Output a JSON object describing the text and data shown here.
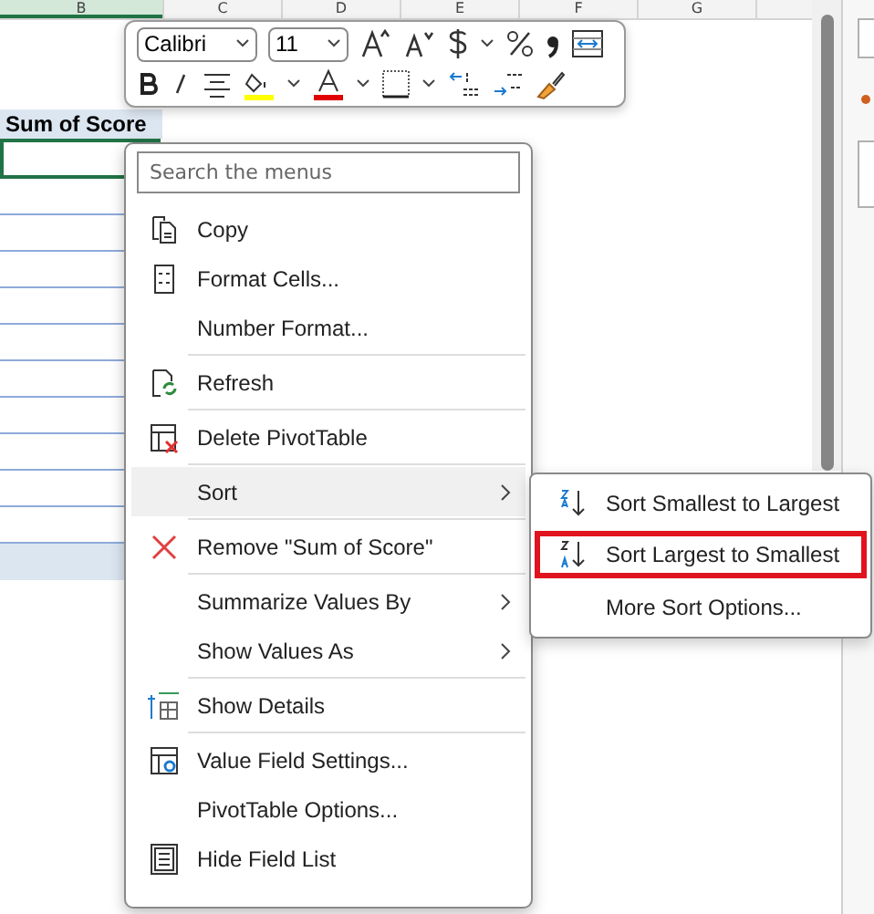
{
  "sheet": {
    "columns": [
      "B",
      "C",
      "D",
      "E",
      "F",
      "G"
    ],
    "pivot_header": "Sum of Score"
  },
  "mini_toolbar": {
    "font": "Calibri",
    "size": "11"
  },
  "context_menu": {
    "search": {
      "placeholder": "Search the menus"
    },
    "items": [
      {
        "label": "Copy",
        "divider_above": false,
        "selected": false,
        "submenu": false
      },
      {
        "label": "Format Cells...",
        "divider_above": false,
        "selected": false,
        "submenu": false
      },
      {
        "label": "Number Format...",
        "divider_above": false,
        "selected": false,
        "submenu": false
      },
      {
        "label": "Refresh",
        "divider_above": true,
        "selected": false,
        "submenu": false
      },
      {
        "label": "Delete PivotTable",
        "divider_above": true,
        "selected": false,
        "submenu": false
      },
      {
        "label": "Sort",
        "divider_above": true,
        "selected": true,
        "submenu": true
      },
      {
        "label": "Remove \"Sum of Score\"",
        "divider_above": true,
        "selected": false,
        "submenu": false
      },
      {
        "label": "Summarize Values By",
        "divider_above": true,
        "selected": false,
        "submenu": true
      },
      {
        "label": "Show Values As",
        "divider_above": false,
        "selected": false,
        "submenu": true
      },
      {
        "label": "Show Details",
        "divider_above": true,
        "selected": false,
        "submenu": false
      },
      {
        "label": "Value Field Settings...",
        "divider_above": true,
        "selected": false,
        "submenu": false
      },
      {
        "label": "PivotTable Options...",
        "divider_above": false,
        "selected": false,
        "submenu": false
      },
      {
        "label": "Hide Field List",
        "divider_above": false,
        "selected": false,
        "submenu": false
      }
    ]
  },
  "sort_submenu": [
    {
      "label": "Sort Smallest to Largest",
      "highlighted": false
    },
    {
      "label": "Sort Largest to Smallest",
      "highlighted": true
    },
    {
      "label": "More Sort Options...",
      "highlighted": false
    }
  ]
}
